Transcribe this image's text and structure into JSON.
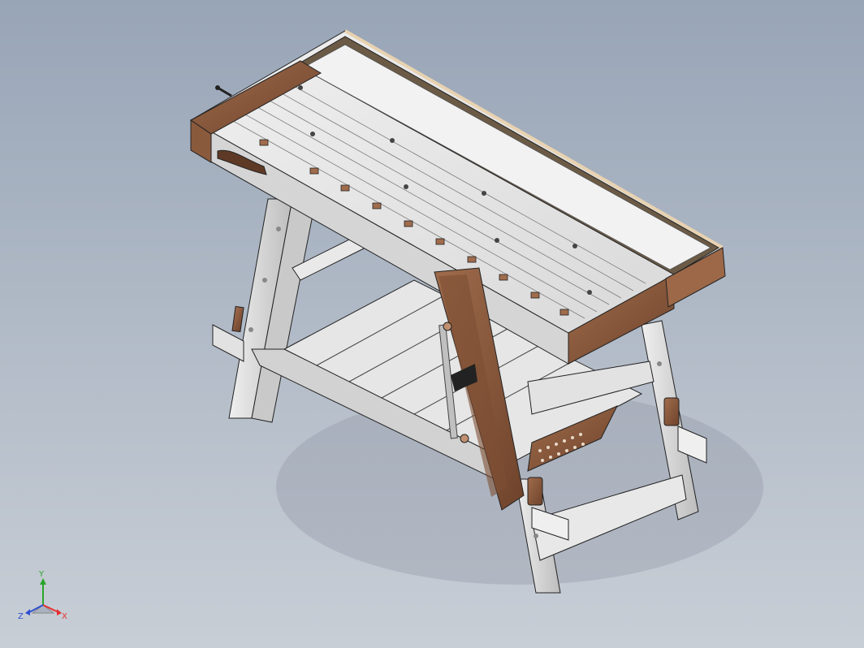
{
  "colors": {
    "background_top": "#98a5b7",
    "background_bottom": "#c8ced6",
    "frame_light": "#e6e6e6",
    "frame_shade": "#b9b9b9",
    "wood": "#8a5a3d",
    "wood_light": "#a06c4c",
    "axis_x": "#e53030",
    "axis_y": "#2aa52a",
    "axis_z": "#3050d0"
  },
  "model": {
    "type": "portable-workbench-assembly",
    "parts": [
      "benchtop",
      "tool-tray",
      "dog-holes",
      "leg-vise",
      "crochet",
      "lower-shelf",
      "sawhorse-legs",
      "wedges"
    ]
  },
  "triad": {
    "x_label": "X",
    "y_label": "Y",
    "z_label": "Z"
  }
}
